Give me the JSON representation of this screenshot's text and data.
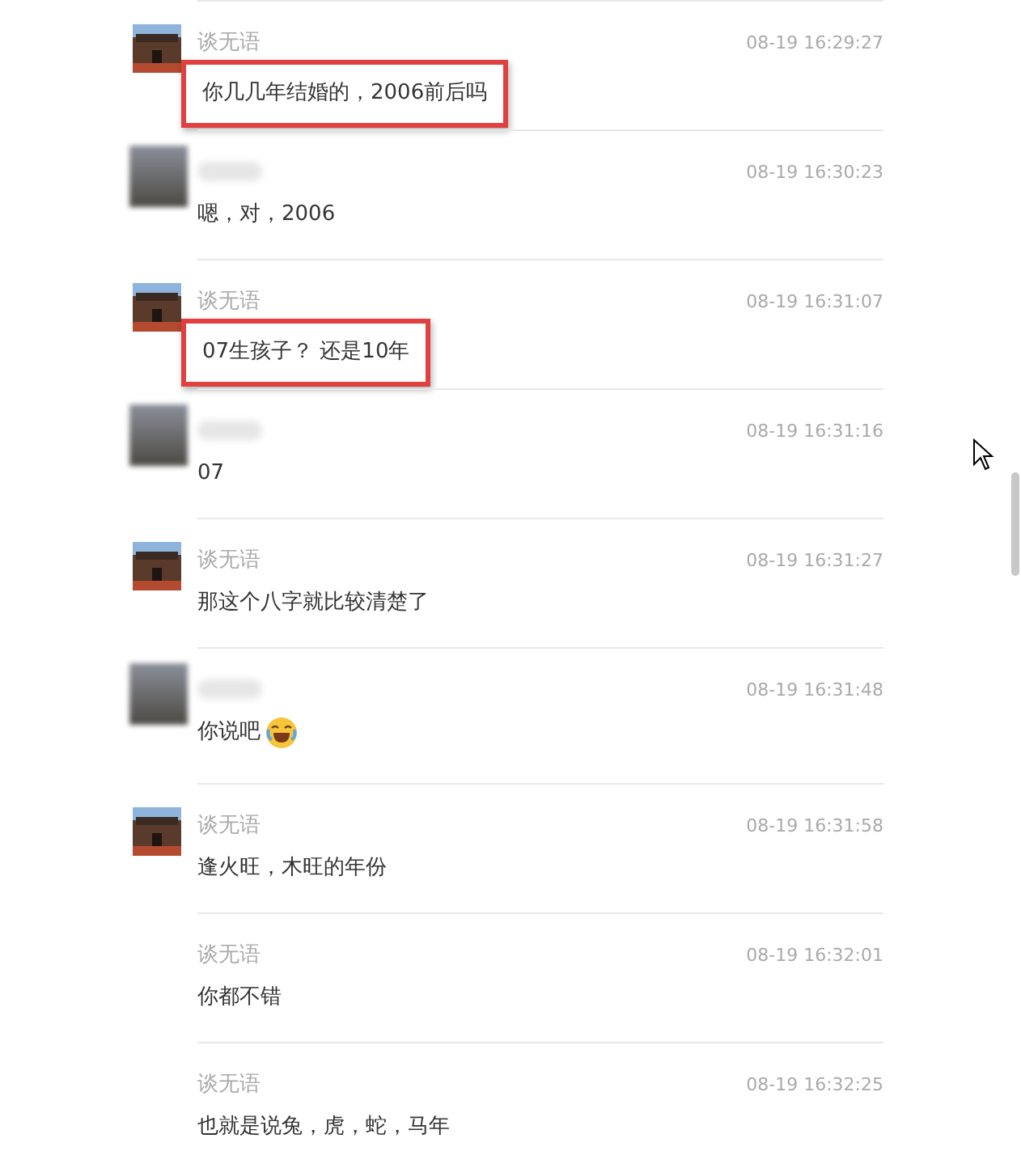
{
  "messages": [
    {
      "kind": "own",
      "sender": "谈无语",
      "time": "08-19 16:29:27",
      "text": "你几几年结婚的，2006前后吗",
      "highlighted": true,
      "emoji": false
    },
    {
      "kind": "other",
      "time": "08-19 16:30:23",
      "text": "嗯，对，2006",
      "highlighted": false,
      "emoji": false
    },
    {
      "kind": "own",
      "sender": "谈无语",
      "time": "08-19 16:31:07",
      "text": "07生孩子？ 还是10年",
      "highlighted": true,
      "emoji": false
    },
    {
      "kind": "other",
      "time": "08-19 16:31:16",
      "text": "07",
      "highlighted": false,
      "emoji": false
    },
    {
      "kind": "own",
      "sender": "谈无语",
      "time": "08-19 16:31:27",
      "text": "那这个八字就比较清楚了",
      "highlighted": false,
      "emoji": false
    },
    {
      "kind": "other",
      "time": "08-19 16:31:48",
      "text": "你说吧",
      "highlighted": false,
      "emoji": true
    },
    {
      "kind": "own",
      "sender": "谈无语",
      "time": "08-19 16:31:58",
      "text": "逢火旺，木旺的年份",
      "highlighted": false,
      "emoji": false
    },
    {
      "kind": "plain",
      "sender": "谈无语",
      "time": "08-19 16:32:01",
      "text": "你都不错",
      "highlighted": false,
      "emoji": false
    },
    {
      "kind": "plain",
      "sender": "谈无语",
      "time": "08-19 16:32:25",
      "text": "也就是说兔，虎，蛇，马年",
      "highlighted": false,
      "emoji": false
    }
  ]
}
